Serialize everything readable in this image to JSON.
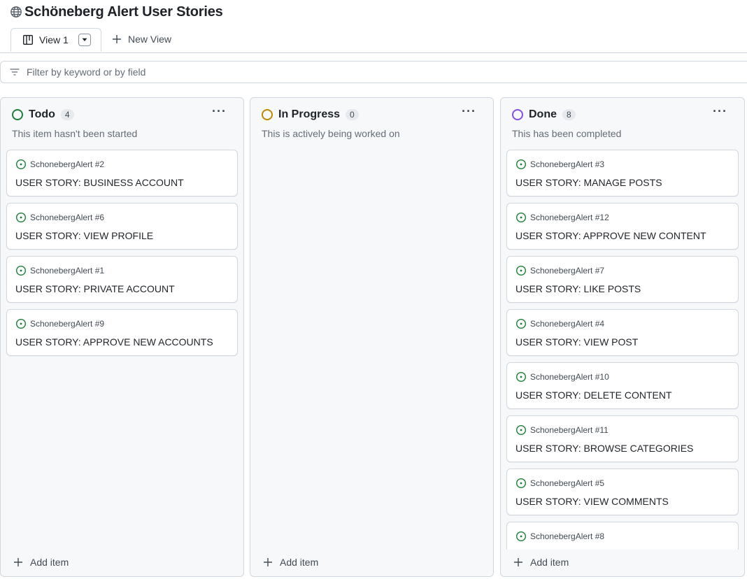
{
  "project": {
    "title": "Schöneberg Alert User Stories"
  },
  "tabs": {
    "active_label": "View 1",
    "new_view_label": "New View"
  },
  "filter": {
    "placeholder": "Filter by keyword or by field"
  },
  "colors": {
    "todo": "#1a7f37",
    "in_progress": "#bf8700",
    "done": "#8250df",
    "issue_icon": "#1a7f37"
  },
  "columns": {
    "todo": {
      "name": "Todo",
      "count": "4",
      "description": "This item hasn't been started",
      "add_label": "Add item",
      "cards": [
        {
          "ref": "SchonebergAlert #2",
          "title": "USER STORY: BUSINESS ACCOUNT"
        },
        {
          "ref": "SchonebergAlert #6",
          "title": "USER STORY: VIEW PROFILE"
        },
        {
          "ref": "SchonebergAlert #1",
          "title": "USER STORY: PRIVATE ACCOUNT"
        },
        {
          "ref": "SchonebergAlert #9",
          "title": "USER STORY: APPROVE NEW ACCOUNTS"
        }
      ]
    },
    "in_progress": {
      "name": "In Progress",
      "count": "0",
      "description": "This is actively being worked on",
      "add_label": "Add item",
      "cards": []
    },
    "done": {
      "name": "Done",
      "count": "8",
      "description": "This has been completed",
      "add_label": "Add item",
      "cards": [
        {
          "ref": "SchonebergAlert #3",
          "title": "USER STORY: MANAGE POSTS"
        },
        {
          "ref": "SchonebergAlert #12",
          "title": "USER STORY: APPROVE NEW CONTENT"
        },
        {
          "ref": "SchonebergAlert #7",
          "title": "USER STORY: LIKE POSTS"
        },
        {
          "ref": "SchonebergAlert #4",
          "title": "USER STORY: VIEW POST"
        },
        {
          "ref": "SchonebergAlert #10",
          "title": "USER STORY: DELETE CONTENT"
        },
        {
          "ref": "SchonebergAlert #11",
          "title": "USER STORY: BROWSE CATEGORIES"
        },
        {
          "ref": "SchonebergAlert #5",
          "title": "USER STORY: VIEW COMMENTS"
        },
        {
          "ref": "SchonebergAlert #8",
          "title": ""
        }
      ]
    }
  }
}
